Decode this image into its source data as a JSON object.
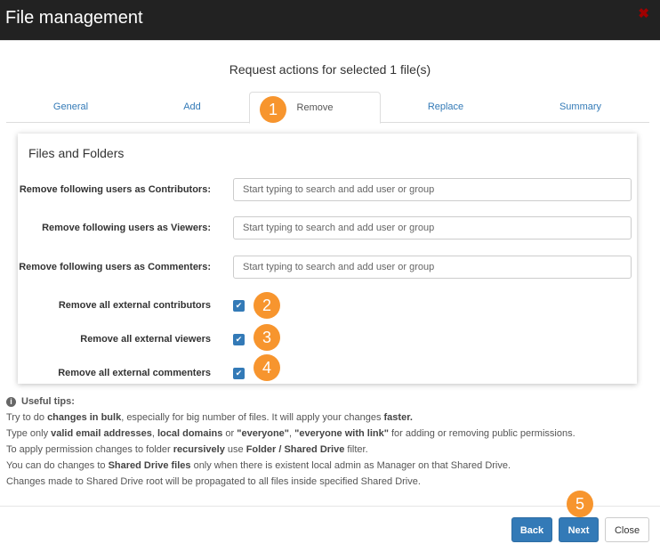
{
  "header": {
    "title": "File management",
    "close_icon": "close-icon"
  },
  "subtitle": "Request actions for selected 1 file(s)",
  "tabs": [
    {
      "label": "General"
    },
    {
      "label": "Add"
    },
    {
      "label": "Remove",
      "active": true
    },
    {
      "label": "Replace"
    },
    {
      "label": "Summary"
    }
  ],
  "panel": {
    "title": "Files and Folders",
    "fields": [
      {
        "label": "Remove following users as Contributors:",
        "value": "",
        "placeholder": "Start typing to search and add user or group"
      },
      {
        "label": "Remove following users as Viewers:",
        "value": "",
        "placeholder": "Start typing to search and add user or group"
      },
      {
        "label": "Remove following users as Commenters:",
        "value": "",
        "placeholder": "Start typing to search and add user or group"
      }
    ],
    "checkboxes": [
      {
        "label": "Remove all external contributors",
        "checked": true
      },
      {
        "label": "Remove all external viewers",
        "checked": true
      },
      {
        "label": "Remove all external commenters",
        "checked": true
      }
    ]
  },
  "tips": {
    "heading": "Useful tips:",
    "lines": [
      [
        "Try to do ",
        {
          "b": "changes in bulk"
        },
        ", especially for big number of files. It will apply your changes ",
        {
          "b": "faster."
        }
      ],
      [
        "Type only ",
        {
          "b": "valid email addresses"
        },
        ", ",
        {
          "b": "local domains"
        },
        " or ",
        {
          "b": "\"everyone\""
        },
        ", ",
        {
          "b": "\"everyone with link\""
        },
        " for adding or removing public permissions."
      ],
      [
        "To apply permission changes to folder ",
        {
          "b": "recursively"
        },
        " use ",
        {
          "b": "Folder / Shared Drive"
        },
        " filter."
      ],
      [
        "You can do changes to ",
        {
          "b": "Shared Drive files"
        },
        " only when there is existent local admin as Manager on that Shared Drive."
      ],
      [
        "Changes made to Shared Drive root will be propagated to all files inside specified Shared Drive."
      ]
    ]
  },
  "badges": [
    "1",
    "2",
    "3",
    "4",
    "5"
  ],
  "buttons": {
    "back": "Back",
    "next": "Next",
    "close": "Close"
  },
  "colors": {
    "accent": "#337ab7",
    "badge": "#f7952e",
    "header_bg": "#222222",
    "close_x": "#a00000"
  }
}
